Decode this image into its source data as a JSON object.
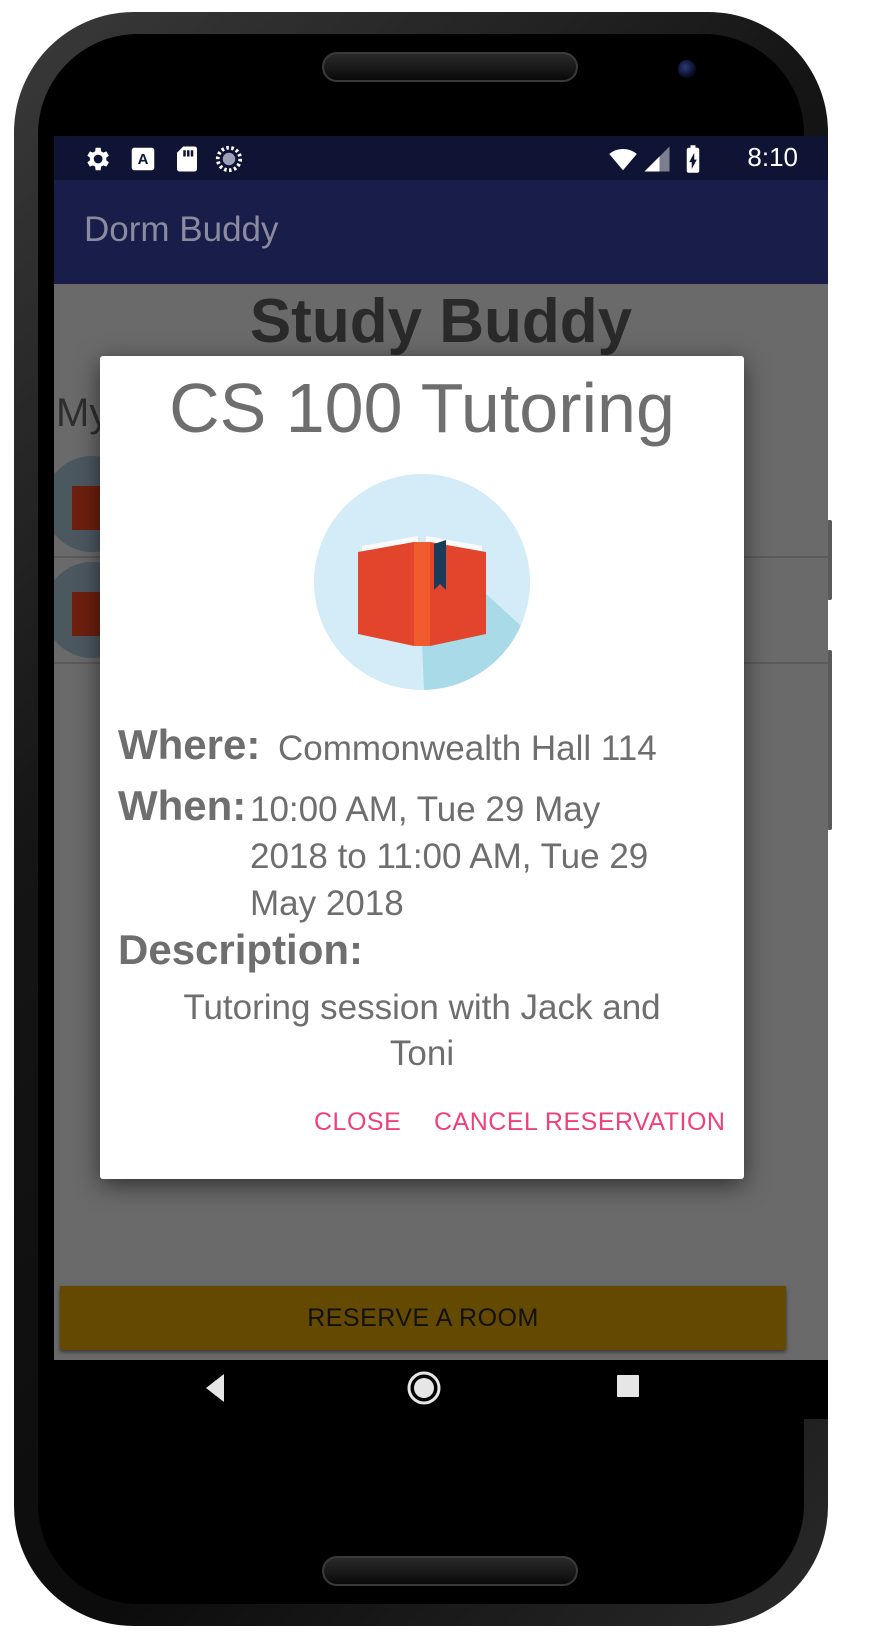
{
  "status_bar": {
    "time": "8:10",
    "left_icons": [
      "gear-icon",
      "a-keyboard-icon",
      "sd-card-icon",
      "spinner-icon"
    ],
    "right_icons": [
      "wifi-icon",
      "cell-signal-icon",
      "battery-charging-icon"
    ]
  },
  "app_bar": {
    "title": "Dorm Buddy"
  },
  "page": {
    "title": "Study Buddy",
    "section_label_partial": "My"
  },
  "dialog": {
    "title": "CS 100 Tutoring",
    "image_icon": "book-icon",
    "where_label": "Where:",
    "where_value": "Commonwealth Hall  114",
    "when_label": "When:",
    "when_line1": "10:00 AM, Tue 29 May",
    "when_line2": "2018 to 11:00 AM, Tue 29",
    "when_line3": "May 2018",
    "description_label": "Description:",
    "description_line1": "Tutoring session with  Jack and",
    "description_line2": "Toni",
    "close_button": "CLOSE",
    "cancel_button": "CANCEL RESERVATION"
  },
  "reserve_button": "RESERVE A ROOM",
  "nav_bar": {
    "back": "back-icon",
    "home": "home-icon",
    "recents": "recents-icon"
  },
  "colors": {
    "status_bar": "#0f1434",
    "app_bar": "#181d49",
    "accent": "#f0407c",
    "reserve_button": "#644a00",
    "dimmed_background": "#6a6a6a"
  }
}
